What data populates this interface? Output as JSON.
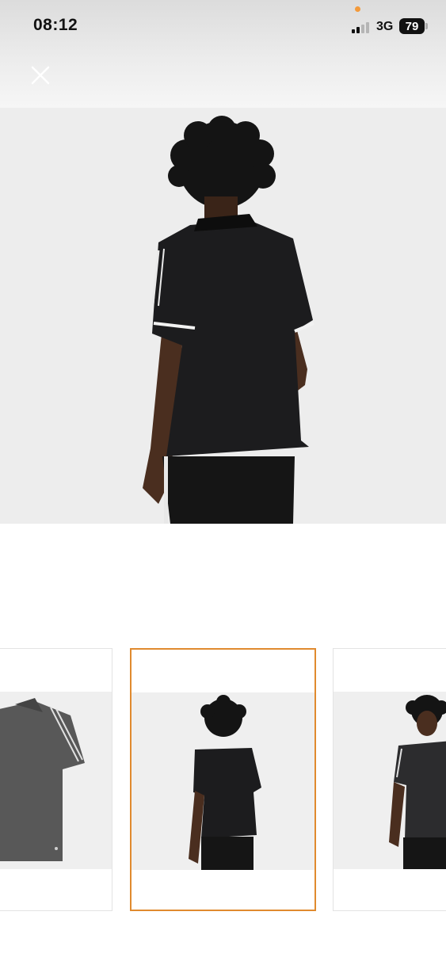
{
  "status_bar": {
    "time": "08:12",
    "network": "3G",
    "battery": "79"
  },
  "icons": {
    "close": "close-icon",
    "signal": "signal-bars-icon"
  },
  "gallery": {
    "main_image": "polo-shirt-back-view",
    "thumbnails": [
      {
        "image": "polo-shirt-flat"
      },
      {
        "image": "polo-shirt-back-view",
        "selected": true
      },
      {
        "image": "polo-shirt-front-view"
      }
    ]
  },
  "colors": {
    "accent": "#e08a2e",
    "status_dot": "#f39a3b",
    "shirt": "#1c1c1e",
    "background": "#ededed"
  }
}
